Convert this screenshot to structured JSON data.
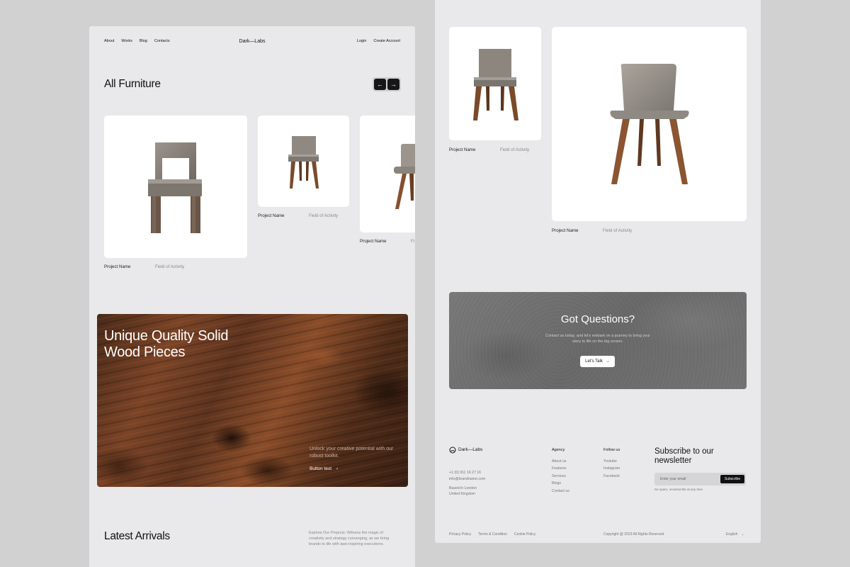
{
  "nav": {
    "links": [
      "About",
      "Works",
      "Blog",
      "Contacts"
    ],
    "brand": "Dark—Labs",
    "login": "Login",
    "create_account": "Create Account"
  },
  "all_furniture": {
    "title": "All Furniture",
    "prev_icon": "arrow-left-icon",
    "next_icon": "arrow-right-icon"
  },
  "cards": [
    {
      "name": "Project Name",
      "field": "Field of Activity"
    },
    {
      "name": "Project Name",
      "field": "Field of Activity"
    },
    {
      "name": "Project Name",
      "field": "Fi"
    },
    {
      "name": "Project Name",
      "field": "Field of Activity"
    },
    {
      "name": "Project Name",
      "field": "Field of Activity"
    }
  ],
  "hero": {
    "title_line1": "Unique Quality Solid",
    "title_line2": "Wood Pieces",
    "subtitle": "Unlock your creative potential with our robust toolkit.",
    "button": "Button text"
  },
  "latest": {
    "title": "Latest Arrivals",
    "text": "Explore Our Projects: Witness the magic of creativity and strategy converging, as we bring brands to life with awe-inspiring executions."
  },
  "cta": {
    "title": "Got Questions?",
    "text": "Contact us today, and let's embark on a journey to bring your story to life on the big screen.",
    "button": "Let's Talk"
  },
  "footer": {
    "brand": "Dark—Labs",
    "phone": "+1 (0) 911 16 27 16",
    "email": "info@brandname.com",
    "location_line1": "Based in London",
    "location_line2": "United Kingdom",
    "agency_title": "Agency",
    "agency_links": [
      "About us",
      "Features",
      "Services",
      "Blogs",
      "Contact us"
    ],
    "follow_title": "Follow us",
    "follow_links": [
      "Youtube",
      "Instagram",
      "Facebook"
    ],
    "newsletter_title": "Subscribe to our newsletter",
    "email_placeholder": "Enter your email",
    "subscribe": "Subscribe",
    "no_spam": "No spam, unsubscribe at any time",
    "bottom_links": [
      "Privacy Policy",
      "Terms & Condition",
      "Cookie Policy"
    ],
    "copyright": "Copyright @ 2023 All Rights Reserved",
    "language": "English"
  },
  "colors": {
    "page_bg": "#d1d1d1",
    "panel_bg": "#e9e9eb",
    "dark": "#111111",
    "wood": "#7b4427",
    "concrete": "#727272"
  }
}
